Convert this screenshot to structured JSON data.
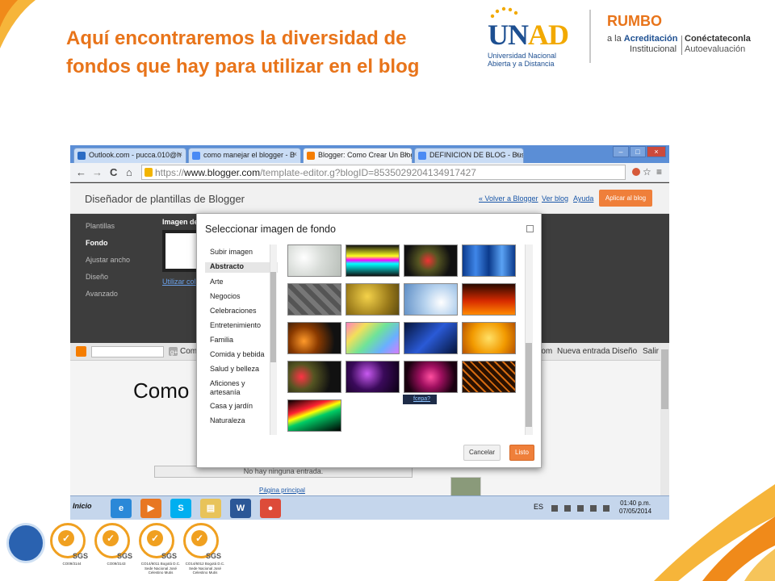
{
  "slide": {
    "title": "Aquí encontraremos la diversidad de fondos que hay  para utilizar en el blog"
  },
  "logos": {
    "unad_letters_1": "UN",
    "unad_letters_2": "AD",
    "unad_sub1": "Universidad Nacional",
    "unad_sub2": "Abierta y a Distancia",
    "rumbo_word": "RUMBO",
    "rumbo_line1_prefix": "a la ",
    "rumbo_line1_bold": "Acreditación",
    "rumbo_line2": "Institucional",
    "conectate_bold": "Conéctateconla",
    "conectate_sub": "Autoevaluación"
  },
  "browser": {
    "tabs": [
      {
        "label": "Outlook.com - pucca.010@h",
        "favicon_color": "#2a6bc4"
      },
      {
        "label": "como manejar el blogger - B",
        "favicon_color": "#4a8af4"
      },
      {
        "label": "Blogger: Como Crear Un Blog",
        "favicon_color": "#f57d00"
      },
      {
        "label": "DEFINICION DE BLOG - Busc",
        "favicon_color": "#4a8af4"
      }
    ],
    "tab_close": "×",
    "window_buttons": {
      "minimize": "–",
      "maximize": "□",
      "close": "×"
    },
    "url_prefix": "https://",
    "url_domain": "www.blogger.com",
    "url_path": "/template-editor.g?blogID=8535029204134917427",
    "nav_back": "←",
    "nav_forward": "→",
    "reload": "C",
    "home": "⌂"
  },
  "blogger": {
    "header_title": "Diseñador de plantillas de Blogger",
    "link_back": "« Volver a Blogger",
    "link_view": "Ver blog",
    "link_help": "Ayuda",
    "apply_button": "Aplicar al blog",
    "nav": [
      {
        "label": "Plantillas",
        "active": false
      },
      {
        "label": "Fondo",
        "active": true
      },
      {
        "label": "Ajustar ancho",
        "active": false
      },
      {
        "label": "Diseño",
        "active": false
      },
      {
        "label": "Avanzado",
        "active": false
      }
    ],
    "image_label": "Imagen de",
    "image_link": "Utilizar col"
  },
  "preview": {
    "search_label": "Comp",
    "links": [
      "rom",
      "Nueva entrada",
      "Diseño",
      "Salir"
    ],
    "blog_title": "Como C",
    "no_entries": "No hay ninguna entrada.",
    "main_page": "Página principal"
  },
  "dialog": {
    "title": "Seleccionar imagen de fondo",
    "categories": [
      {
        "label": "Subir imagen",
        "active": false
      },
      {
        "label": "Abstracto",
        "active": true
      },
      {
        "label": "Arte",
        "active": false
      },
      {
        "label": "Negocios",
        "active": false
      },
      {
        "label": "Celebraciones",
        "active": false
      },
      {
        "label": "Entretenimiento",
        "active": false
      },
      {
        "label": "Familia",
        "active": false
      },
      {
        "label": "Comida y bebida",
        "active": false
      },
      {
        "label": "Salud y belleza",
        "active": false
      },
      {
        "label": "Aficiones y artesanía",
        "active": false
      },
      {
        "label": "Casa y jardín",
        "active": false
      },
      {
        "label": "Naturaleza",
        "active": false
      }
    ],
    "thumbnails": [
      {
        "name": "bokeh-white",
        "gradient": "radial-gradient(circle at 30% 40%, #ffffff, #d8dcd8 45%, #b8beb8)"
      },
      {
        "name": "neon-lines",
        "gradient": "linear-gradient(180deg, #111 0%, #ff2 35%, #f0f 48%, #0ff 60%, #111 100%)"
      },
      {
        "name": "red-green-bokeh",
        "gradient": "radial-gradient(circle at 45% 50%, #e33 0%, #552 30%, #111 70%)"
      },
      {
        "name": "blue-light-rays",
        "gradient": "linear-gradient(90deg, #0b3a8c, #3f86e8, #0b3a8c, #5aa2f4, #0b3a8c)"
      },
      {
        "name": "grey-squares",
        "gradient": "repeating-linear-gradient(45deg, #555 0 6px, #777 6px 12px)"
      },
      {
        "name": "golden-texture",
        "gradient": "radial-gradient(circle at 40% 40%, #f4d24a, #9a7a1a 60%, #5c4a10)"
      },
      {
        "name": "blue-swirl",
        "gradient": "radial-gradient(circle at 70% 60%, #ffffff 0%, #b6d2ee 40%, #5c8cc4 100%)"
      },
      {
        "name": "flames",
        "gradient": "linear-gradient(0deg, #ff8a00 0%, #d72a00 45%, #2a0a00 100%)"
      },
      {
        "name": "orange-sparks",
        "gradient": "radial-gradient(circle at 30% 60%, #ff9a2a 0%, #8a3a00 35%, #111 75%)"
      },
      {
        "name": "rainbow-glitter",
        "gradient": "linear-gradient(135deg, #ff7fbf, #f2e05a, #6ee39a, #6ab0ff, #d57bff)"
      },
      {
        "name": "blue-streaks",
        "gradient": "linear-gradient(135deg, #05143a, #2a5ad6 50%, #05143a)"
      },
      {
        "name": "yellow-swirls",
        "gradient": "radial-gradient(circle at 50% 50%, #ffe066, #f29a00 55%, #b65200)"
      },
      {
        "name": "city-bokeh",
        "gradient": "radial-gradient(circle at 25% 50%, #ff3344 0%, #552 30%, #111 70%)"
      },
      {
        "name": "purple-fireworks",
        "gradient": "radial-gradient(circle at 40% 40%, #c85af0 0%, #3a0a5a 45%, #0a0012)"
      },
      {
        "name": "pink-bokeh",
        "gradient": "radial-gradient(circle at 50% 50%, #ff4fa0 0%, #a01060 35%, #1a0010 80%)"
      },
      {
        "name": "orange-circuit",
        "gradient": "repeating-linear-gradient(45deg, #2a1100 0 5px, #d46a10 5px 7px)"
      },
      {
        "name": "light-trails",
        "gradient": "linear-gradient(160deg, #000 0%, #f23 30%, #ff0 42%, #0c6 55%, #000 100%)"
      }
    ],
    "author_badge": "fcepa?",
    "cancel_button": "Cancelar",
    "done_button": "Listo"
  },
  "taskbar": {
    "start_label": "Inicio",
    "apps": [
      {
        "name": "internet-explorer",
        "glyph": "e",
        "color": "#2a88d8"
      },
      {
        "name": "media-player",
        "glyph": "▶",
        "color": "#e87722"
      },
      {
        "name": "skype",
        "glyph": "S",
        "color": "#00aff0"
      },
      {
        "name": "file-explorer",
        "glyph": "▤",
        "color": "#e8c35a"
      },
      {
        "name": "word",
        "glyph": "W",
        "color": "#2b5797"
      },
      {
        "name": "chrome",
        "glyph": "●",
        "color": "#dd4b39"
      }
    ],
    "language": "ES",
    "time": "01:40 p.m.",
    "date": "07/05/2014"
  },
  "seals": [
    {
      "code": "CO09/3144"
    },
    {
      "code": "CO09/3143"
    },
    {
      "code": "CO14/6011 Bogotá D.C. Sede Nacional José Celestino Mutis"
    },
    {
      "code": "CO14/6012 Bogotá D.C. Sede Nacional José Celestino Mutis"
    }
  ],
  "seal_check": "✓",
  "seal_brand": "SGS",
  "colors": {
    "accent_orange": "#e8741a",
    "unad_blue": "#1d4f91",
    "blogger_orange": "#ef7f3a"
  }
}
